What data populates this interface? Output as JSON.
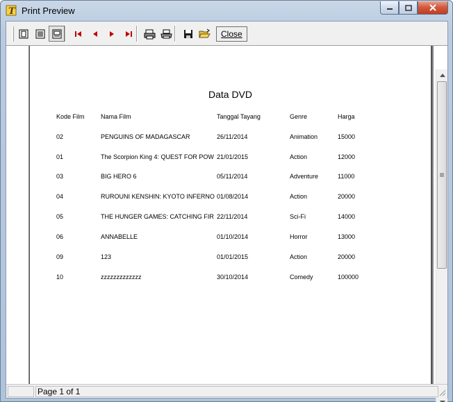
{
  "window": {
    "title": "Print Preview"
  },
  "toolbar": {
    "close_label": "Close"
  },
  "report": {
    "title": "Data DVD",
    "headers": {
      "kode": "Kode Film",
      "nama": "Nama Film",
      "tanggal": "Tanggal Tayang",
      "genre": "Genre",
      "harga": "Harga"
    },
    "rows": [
      {
        "kode": "02",
        "nama": "PENGUINS OF MADAGASCAR",
        "tanggal": "26/11/2014",
        "genre": "Animation",
        "harga": "15000"
      },
      {
        "kode": "01",
        "nama": "The Scorpion King 4: QUEST FOR POW",
        "tanggal": "21/01/2015",
        "genre": "Action",
        "harga": "12000"
      },
      {
        "kode": "03",
        "nama": "BIG HERO 6",
        "tanggal": "05/11/2014",
        "genre": "Adventure",
        "harga": "11000"
      },
      {
        "kode": "04",
        "nama": "RUROUNI KENSHIN: KYOTO INFERNO",
        "tanggal": "01/08/2014",
        "genre": "Action",
        "harga": "20000"
      },
      {
        "kode": "05",
        "nama": "THE HUNGER GAMES: CATCHING FIR",
        "tanggal": "22/11/2014",
        "genre": "Sci-Fi",
        "harga": "14000"
      },
      {
        "kode": "06",
        "nama": "ANNABELLE",
        "tanggal": "01/10/2014",
        "genre": "Horror",
        "harga": "13000"
      },
      {
        "kode": "09",
        "nama": "123",
        "tanggal": "01/01/2015",
        "genre": "Action",
        "harga": "20000"
      },
      {
        "kode": "10",
        "nama": "zzzzzzzzzzzzz",
        "tanggal": "30/10/2014",
        "genre": "Comedy",
        "harga": "100000"
      }
    ]
  },
  "status": {
    "page_info": "Page 1 of 1"
  },
  "icons": {
    "toolbar": [
      "single-page-icon",
      "multi-page-icon",
      "page-width-icon",
      "first-page-icon",
      "prev-page-icon",
      "next-page-icon",
      "last-page-icon",
      "print-setup-icon",
      "print-icon",
      "save-icon",
      "open-icon"
    ]
  }
}
